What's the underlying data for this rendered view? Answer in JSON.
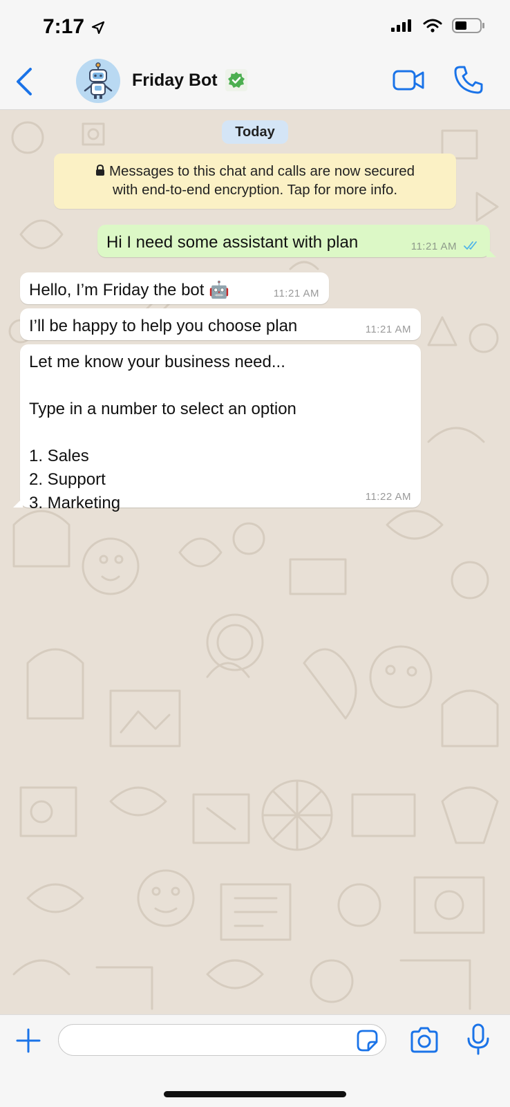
{
  "status_bar": {
    "time": "7:17"
  },
  "header": {
    "contact_name": "Friday Bot"
  },
  "chat": {
    "date_label": "Today",
    "encryption_notice": "Messages to this chat and calls are now secured\nwith end-to-end encryption. Tap for more info.",
    "messages": [
      {
        "direction": "outgoing",
        "text": "Hi I need some assistant with plan",
        "time": "11:21 AM",
        "status": "read"
      },
      {
        "direction": "incoming",
        "text": "Hello, I’m Friday the bot 🤖",
        "time": "11:21 AM"
      },
      {
        "direction": "incoming",
        "text": "I’ll be happy to help you choose plan",
        "time": "11:21 AM"
      },
      {
        "direction": "incoming",
        "text": "Let me know your business need...\n\nType in a number to select an option\n\n1. Sales\n2. Support\n3. Marketing",
        "time": "11:22 AM"
      }
    ]
  },
  "composer": {
    "placeholder": ""
  },
  "colors": {
    "accent": "#1a73e8",
    "outgoing_bubble": "#dcf8c6",
    "incoming_bubble": "#ffffff",
    "verified": "#4caf50",
    "encryption_bg": "#fbf1c5",
    "date_pill_bg": "#d4e5f6"
  }
}
